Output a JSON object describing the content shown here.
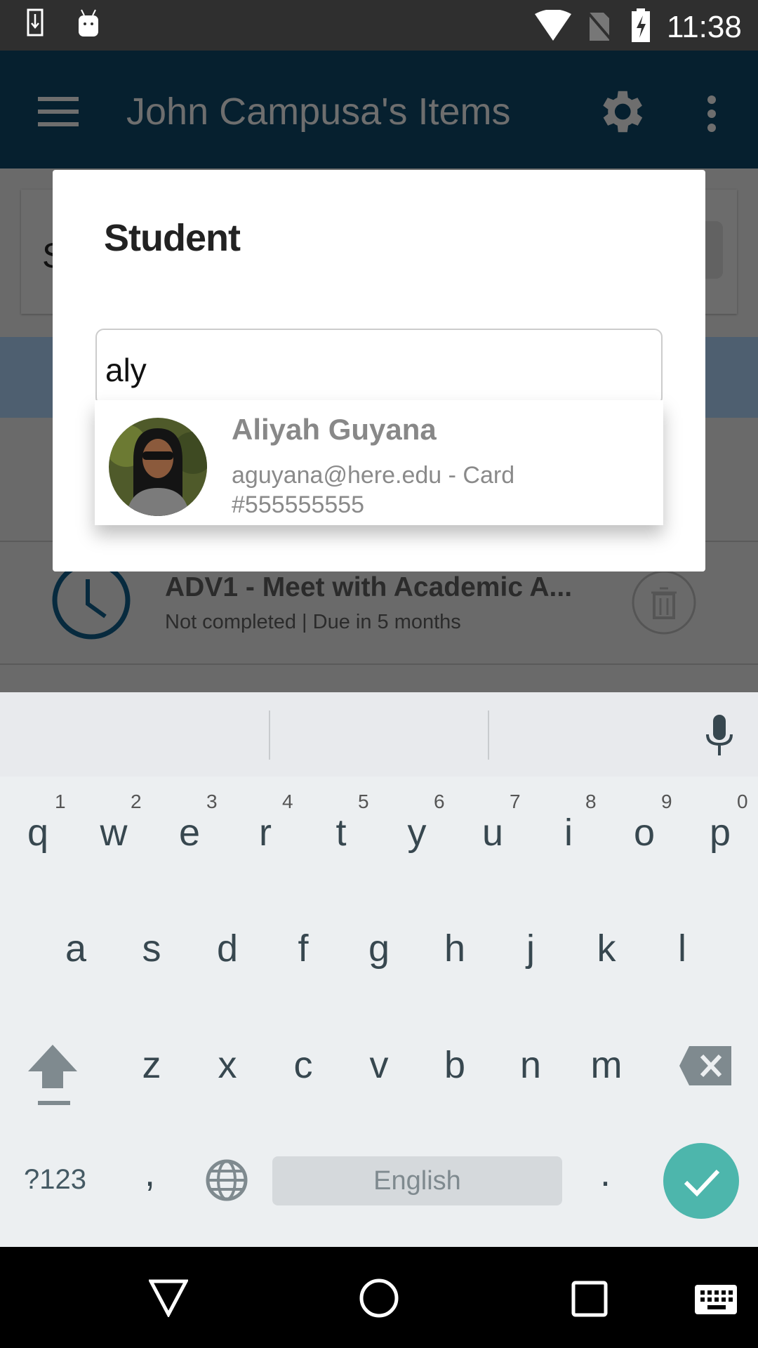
{
  "status_bar": {
    "time": "11:38",
    "icons": [
      "download-icon",
      "android-icon",
      "wifi-icon",
      "no-sim-icon",
      "battery-charging-icon"
    ]
  },
  "app_bar": {
    "title": "John Campusa's Items",
    "icons": [
      "menu-icon",
      "gear-icon",
      "more-vert-icon"
    ]
  },
  "background": {
    "card_initial": "S",
    "list_item": {
      "title": "ADV1 - Meet with Academic A...",
      "subtitle": "Not completed | Due in 5 months"
    }
  },
  "dialog": {
    "title": "Student",
    "input_value": "aly",
    "suggestions": [
      {
        "name": "Aliyah Guyana",
        "detail_line1": "aguyana@here.edu - Card",
        "detail_line2": "#555555555"
      }
    ]
  },
  "keyboard": {
    "row1": [
      "q",
      "w",
      "e",
      "r",
      "t",
      "y",
      "u",
      "i",
      "o",
      "p"
    ],
    "hints": [
      "1",
      "2",
      "3",
      "4",
      "5",
      "6",
      "7",
      "8",
      "9",
      "0"
    ],
    "row2": [
      "a",
      "s",
      "d",
      "f",
      "g",
      "h",
      "j",
      "k",
      "l"
    ],
    "row3": [
      "z",
      "x",
      "c",
      "v",
      "b",
      "n",
      "m"
    ],
    "symbols_label": "?123",
    "comma": ",",
    "period": ".",
    "space_label": "English",
    "accent_color": "#4db6ac"
  }
}
